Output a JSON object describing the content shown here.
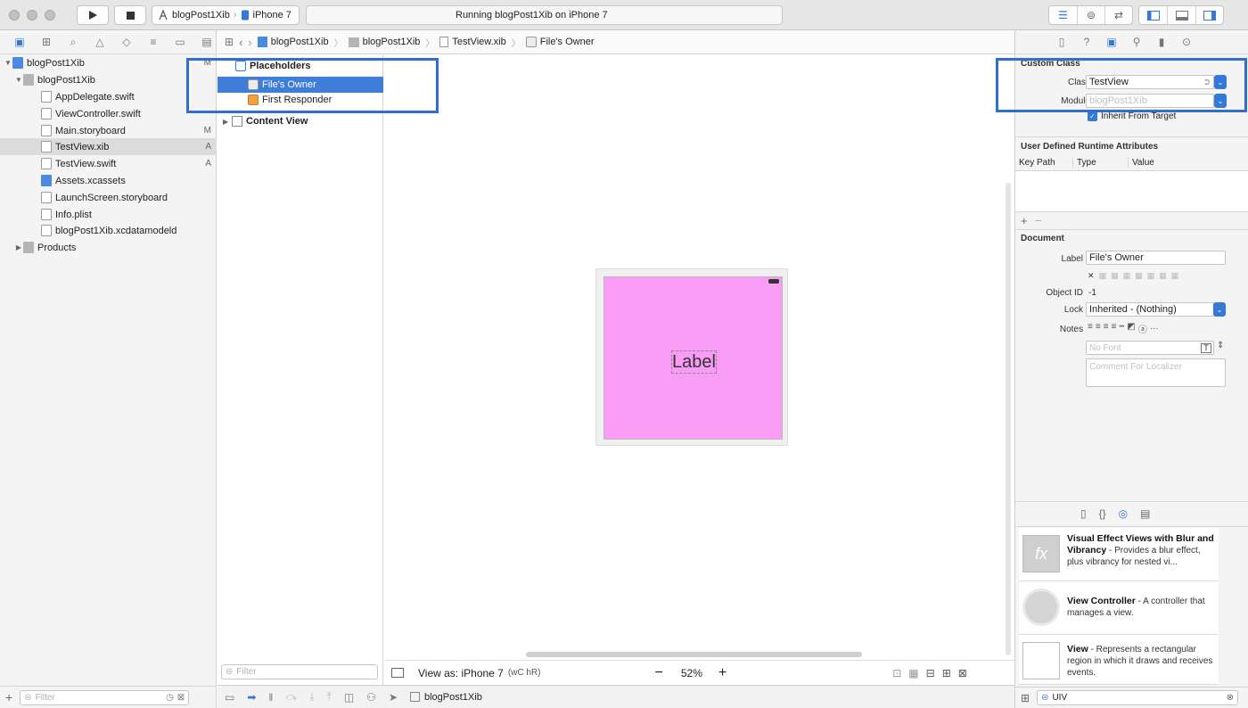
{
  "toolbar": {
    "scheme_name": "blogPost1Xib",
    "device": "iPhone 7",
    "status": "Running blogPost1Xib on iPhone 7"
  },
  "navigator": {
    "items": [
      {
        "label": "blogPost1Xib",
        "status": "M"
      },
      {
        "label": "blogPost1Xib",
        "status": ""
      },
      {
        "label": "AppDelegate.swift",
        "status": ""
      },
      {
        "label": "ViewController.swift",
        "status": ""
      },
      {
        "label": "Main.storyboard",
        "status": "M"
      },
      {
        "label": "TestView.xib",
        "status": "A"
      },
      {
        "label": "TestView.swift",
        "status": "A"
      },
      {
        "label": "Assets.xcassets",
        "status": ""
      },
      {
        "label": "LaunchScreen.storyboard",
        "status": ""
      },
      {
        "label": "Info.plist",
        "status": ""
      },
      {
        "label": "blogPost1Xib.xcdatamodeld",
        "status": ""
      },
      {
        "label": "Products",
        "status": ""
      }
    ],
    "filter_placeholder": "Filter"
  },
  "jumpbar": {
    "crumbs": [
      "blogPost1Xib",
      "blogPost1Xib",
      "TestView.xib",
      "File's Owner"
    ]
  },
  "outline": {
    "placeholders": "Placeholders",
    "files_owner": "File's Owner",
    "first_responder": "First Responder",
    "content_view": "Content View",
    "filter_placeholder": "Filter"
  },
  "canvas": {
    "label_text": "Label",
    "view_as": "View as: iPhone 7",
    "size_class": "(wC hR)",
    "zoom": "52%"
  },
  "debug": {
    "target": "blogPost1Xib"
  },
  "inspector": {
    "custom_class": {
      "title": "Custom Class",
      "class_label": "Class",
      "class_value": "TestView",
      "module_label": "Module",
      "module_placeholder": "blogPost1Xib",
      "inherit": "Inherit From Target"
    },
    "runtime_attributes": {
      "title": "User Defined Runtime Attributes",
      "columns": [
        "Key Path",
        "Type",
        "Value"
      ]
    },
    "document": {
      "title": "Document",
      "label_label": "Label",
      "label_value": "File's Owner",
      "object_id_label": "Object ID",
      "object_id_value": "-1",
      "lock_label": "Lock",
      "lock_value": "Inherited - (Nothing)",
      "notes_label": "Notes",
      "font_placeholder": "No Font",
      "comment_placeholder": "Comment For Localizer"
    },
    "library": [
      {
        "title": "Visual Effect Views with Blur and Vibrancy",
        "desc": "Provides a blur effect, plus vibrancy for nested vi..."
      },
      {
        "title": "View Controller",
        "desc": "A controller that manages a view."
      },
      {
        "title": "View",
        "desc": "Represents a rectangular region in which it draws and receives events."
      }
    ],
    "library_search": "UIV"
  },
  "colors": {
    "accent": "#3478d8",
    "highlight_box": "#2f6fd2",
    "view_background": "#f99cf5"
  }
}
